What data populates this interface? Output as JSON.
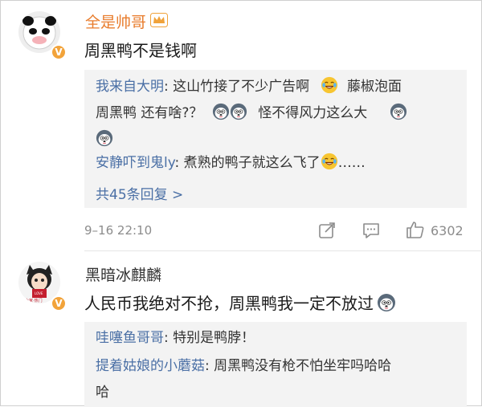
{
  "comments": [
    {
      "username": "全是帅哥",
      "username_color": "#e87c2c",
      "content": "周黑鸭不是钱啊",
      "replies": [
        {
          "name": "我来自大明",
          "sep": ":",
          "t1": " 这山竹接了不少广告啊",
          "t2": "藤椒泡面",
          "t3": "周黑鸭 还有啥?？",
          "t4": "怪不得风力这么大"
        },
        {
          "name": "安静吓到鬼ly",
          "sep": ":",
          "t1": " 煮熟的鸭子就这么飞了",
          "t2": "……"
        }
      ],
      "more_replies": "共45条回复 >",
      "time": "9–16 22:10",
      "likes": "6302"
    },
    {
      "username": "黑暗冰麒麟",
      "avatar_caption": "LOVE",
      "avatar_sub": "大家·热门",
      "content": "人民币我绝对不抢，周黑鸭我一定不放过",
      "replies": [
        {
          "name": "哇噻鱼哥哥",
          "sep": ":",
          "t1": " 特别是鸭脖！"
        },
        {
          "name": "提着姑娘的小蘑菇",
          "sep": ":",
          "t1": " 周黑鸭没有枪不怕坐牢吗哈哈",
          "t2": "哈"
        }
      ]
    }
  ],
  "icons": {
    "verified": "verified-v-icon",
    "crown": "crown-icon",
    "share": "share-icon",
    "comment": "comment-icon",
    "like": "thumbs-up-icon",
    "laugh": "laughing-tears-emoji",
    "husky": "husky-emoji"
  },
  "colors": {
    "link": "#4a6fa5",
    "reply_bg": "#f3f3f3",
    "meta": "#8c8c8c"
  }
}
